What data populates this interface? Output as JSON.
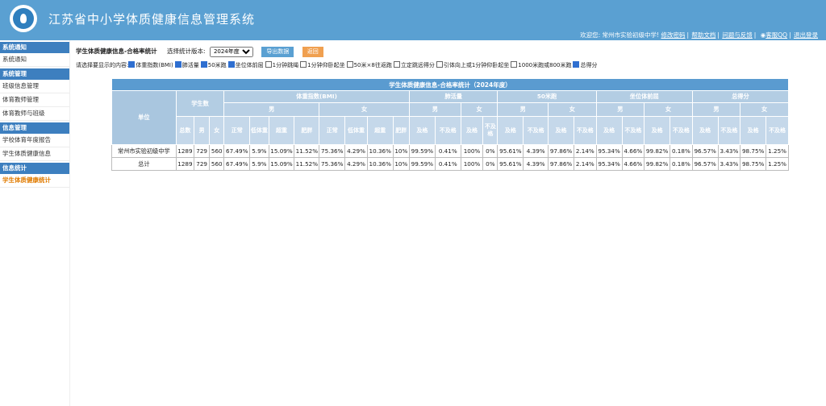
{
  "app": {
    "title": "江苏省中小学体质健康信息管理系统"
  },
  "userbar": {
    "welcome": "欢迎您: 常州市实验初级中学!",
    "links": [
      "修改密码",
      "帮助文档",
      "问题与反馈",
      "客服QQ",
      "退出登录"
    ]
  },
  "sidebar": {
    "sections": [
      {
        "title": "系统通知",
        "items": [
          "系统通知"
        ]
      },
      {
        "title": "系统管理",
        "items": [
          "班级信息管理",
          "体育教师管理",
          "体育教师与班级"
        ]
      },
      {
        "title": "信息管理",
        "items": [
          "学校体育年度报告",
          "学生体质健康信息"
        ]
      },
      {
        "title": "信息统计",
        "items": [
          "学生体质健康统计"
        ]
      }
    ],
    "active": "学生体质健康统计"
  },
  "toolbar": {
    "page_label": "学生体质健康信息-合格率统计",
    "version_label": "选择统计版本:",
    "version_value": "2024年度",
    "export_label": "导出数据",
    "back_label": "返回"
  },
  "filters": {
    "prompt": "请选择要显示的内容:",
    "items": [
      {
        "label": "体重指数(BMI)",
        "checked": true
      },
      {
        "label": "肺活量",
        "checked": true
      },
      {
        "label": "50米跑",
        "checked": true
      },
      {
        "label": "坐位体前屈",
        "checked": true
      },
      {
        "label": "1分钟跳绳",
        "checked": false
      },
      {
        "label": "1分钟仰卧起坐",
        "checked": false
      },
      {
        "label": "50米×8往返跑",
        "checked": false
      },
      {
        "label": "立定跳远得分",
        "checked": false
      },
      {
        "label": "引体向上或1分钟仰卧起坐",
        "checked": false
      },
      {
        "label": "1000米跑或800米跑",
        "checked": false
      },
      {
        "label": "总得分",
        "checked": true
      }
    ]
  },
  "table": {
    "caption": "学生体质健康信息-合格率统计（2024年度）",
    "unit_header": "单位",
    "students_header": "学生数",
    "students_sub": [
      "总数",
      "男",
      "女"
    ],
    "groups": [
      {
        "name": "体重指数(BMI)",
        "male": "男",
        "female": "女",
        "cols": [
          "正常",
          "低体重",
          "超重",
          "肥胖"
        ]
      },
      {
        "name": "肺活量",
        "male": "男",
        "female": "女",
        "cols": [
          "及格",
          "不及格"
        ]
      },
      {
        "name": "50米跑",
        "male": "男",
        "female": "女",
        "cols": [
          "及格",
          "不及格"
        ]
      },
      {
        "name": "坐位体前屈",
        "male": "男",
        "female": "女",
        "cols": [
          "及格",
          "不及格"
        ]
      },
      {
        "name": "总得分",
        "male": "男",
        "female": "女",
        "cols": [
          "及格",
          "不及格"
        ]
      }
    ],
    "rows": [
      {
        "cells": [
          "常州市实验初级中学",
          "1289",
          "729",
          "560",
          "67.49%",
          "5.9%",
          "15.09%",
          "11.52%",
          "75.36%",
          "4.29%",
          "10.36%",
          "10%",
          "99.59%",
          "0.41%",
          "100%",
          "0%",
          "95.61%",
          "4.39%",
          "97.86%",
          "2.14%",
          "95.34%",
          "4.66%",
          "99.82%",
          "0.18%",
          "96.57%",
          "3.43%",
          "98.75%",
          "1.25%"
        ]
      },
      {
        "cells": [
          "总计",
          "1289",
          "729",
          "560",
          "67.49%",
          "5.9%",
          "15.09%",
          "11.52%",
          "75.36%",
          "4.29%",
          "10.36%",
          "10%",
          "99.59%",
          "0.41%",
          "100%",
          "0%",
          "95.61%",
          "4.39%",
          "97.86%",
          "2.14%",
          "95.34%",
          "4.66%",
          "99.82%",
          "0.18%",
          "96.57%",
          "3.43%",
          "98.75%",
          "1.25%"
        ]
      }
    ]
  },
  "colors": {
    "header_bg": "#5aa0d2",
    "sidebar_section": "#3d7fbf",
    "active_item": "#e07b00",
    "export_btn": "#5aa0d2",
    "back_btn": "#f0a050"
  }
}
